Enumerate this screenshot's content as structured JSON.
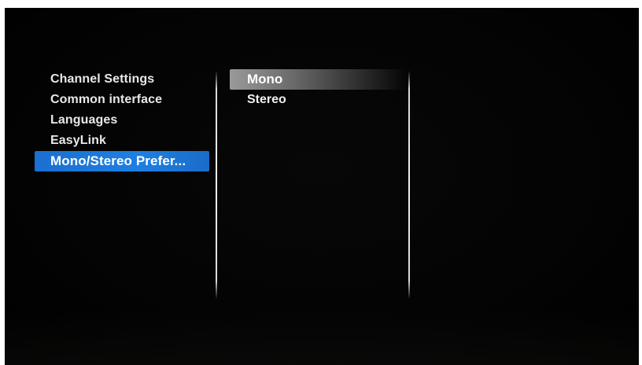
{
  "menu": {
    "items": [
      {
        "label": "Channel Settings"
      },
      {
        "label": "Common interface"
      },
      {
        "label": "Languages"
      },
      {
        "label": "EasyLink"
      },
      {
        "label": "Mono/Stereo Prefer..."
      }
    ],
    "selected_index": 4
  },
  "submenu": {
    "options": [
      {
        "label": "Mono"
      },
      {
        "label": "Stereo"
      }
    ],
    "highlighted_index": 0
  },
  "colors": {
    "selection_blue": "#1f7fe0",
    "background": "#000000",
    "text": "#e8e8e8"
  }
}
